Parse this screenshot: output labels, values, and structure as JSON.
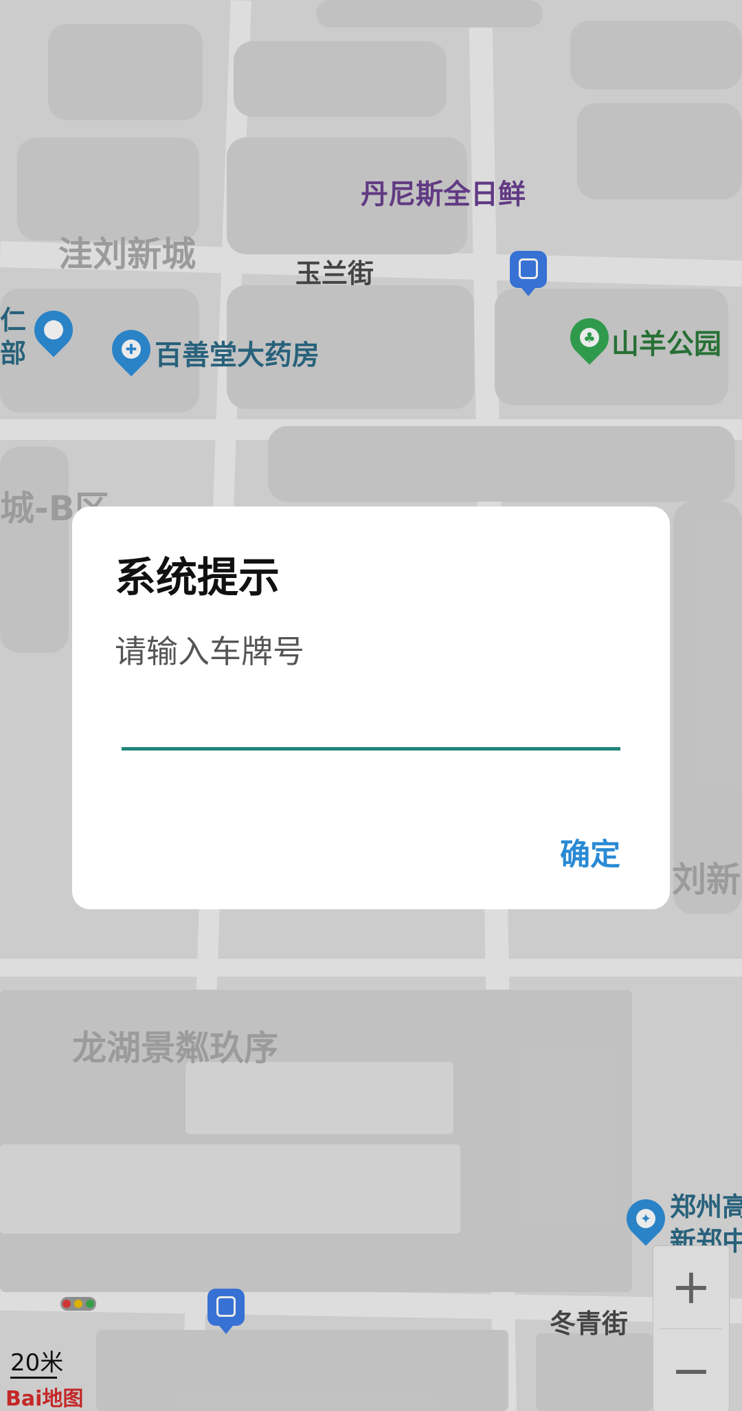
{
  "map": {
    "labels": {
      "wa_liu_xin_cheng": "洼刘新城",
      "yulan_street": "玉兰街",
      "danish_fresh": "丹尼斯全日鲜",
      "shanyang_park": "山羊公园",
      "baishantang": "百善堂大药房",
      "left_partial_1": "仁",
      "left_partial_2": "部",
      "b_area": "城-B区",
      "right_partial": "刘新",
      "longhu": "龙湖景粼玖序",
      "zhengzhou_1": "郑州高",
      "zhengzhou_2": "新郑中",
      "dongqing_street": "冬青街"
    },
    "scale_text": "20米",
    "logo_text": "Bai地图",
    "colors": {
      "traffic_red": "#e23b3b",
      "traffic_yellow": "#f0c000",
      "traffic_green": "#3cae4e"
    }
  },
  "dialog": {
    "title": "系统提示",
    "message": "请输入车牌号",
    "input_value": "",
    "input_placeholder": "",
    "confirm_label": "确定"
  },
  "zoom": {
    "in_label": "+",
    "out_label": "−"
  }
}
